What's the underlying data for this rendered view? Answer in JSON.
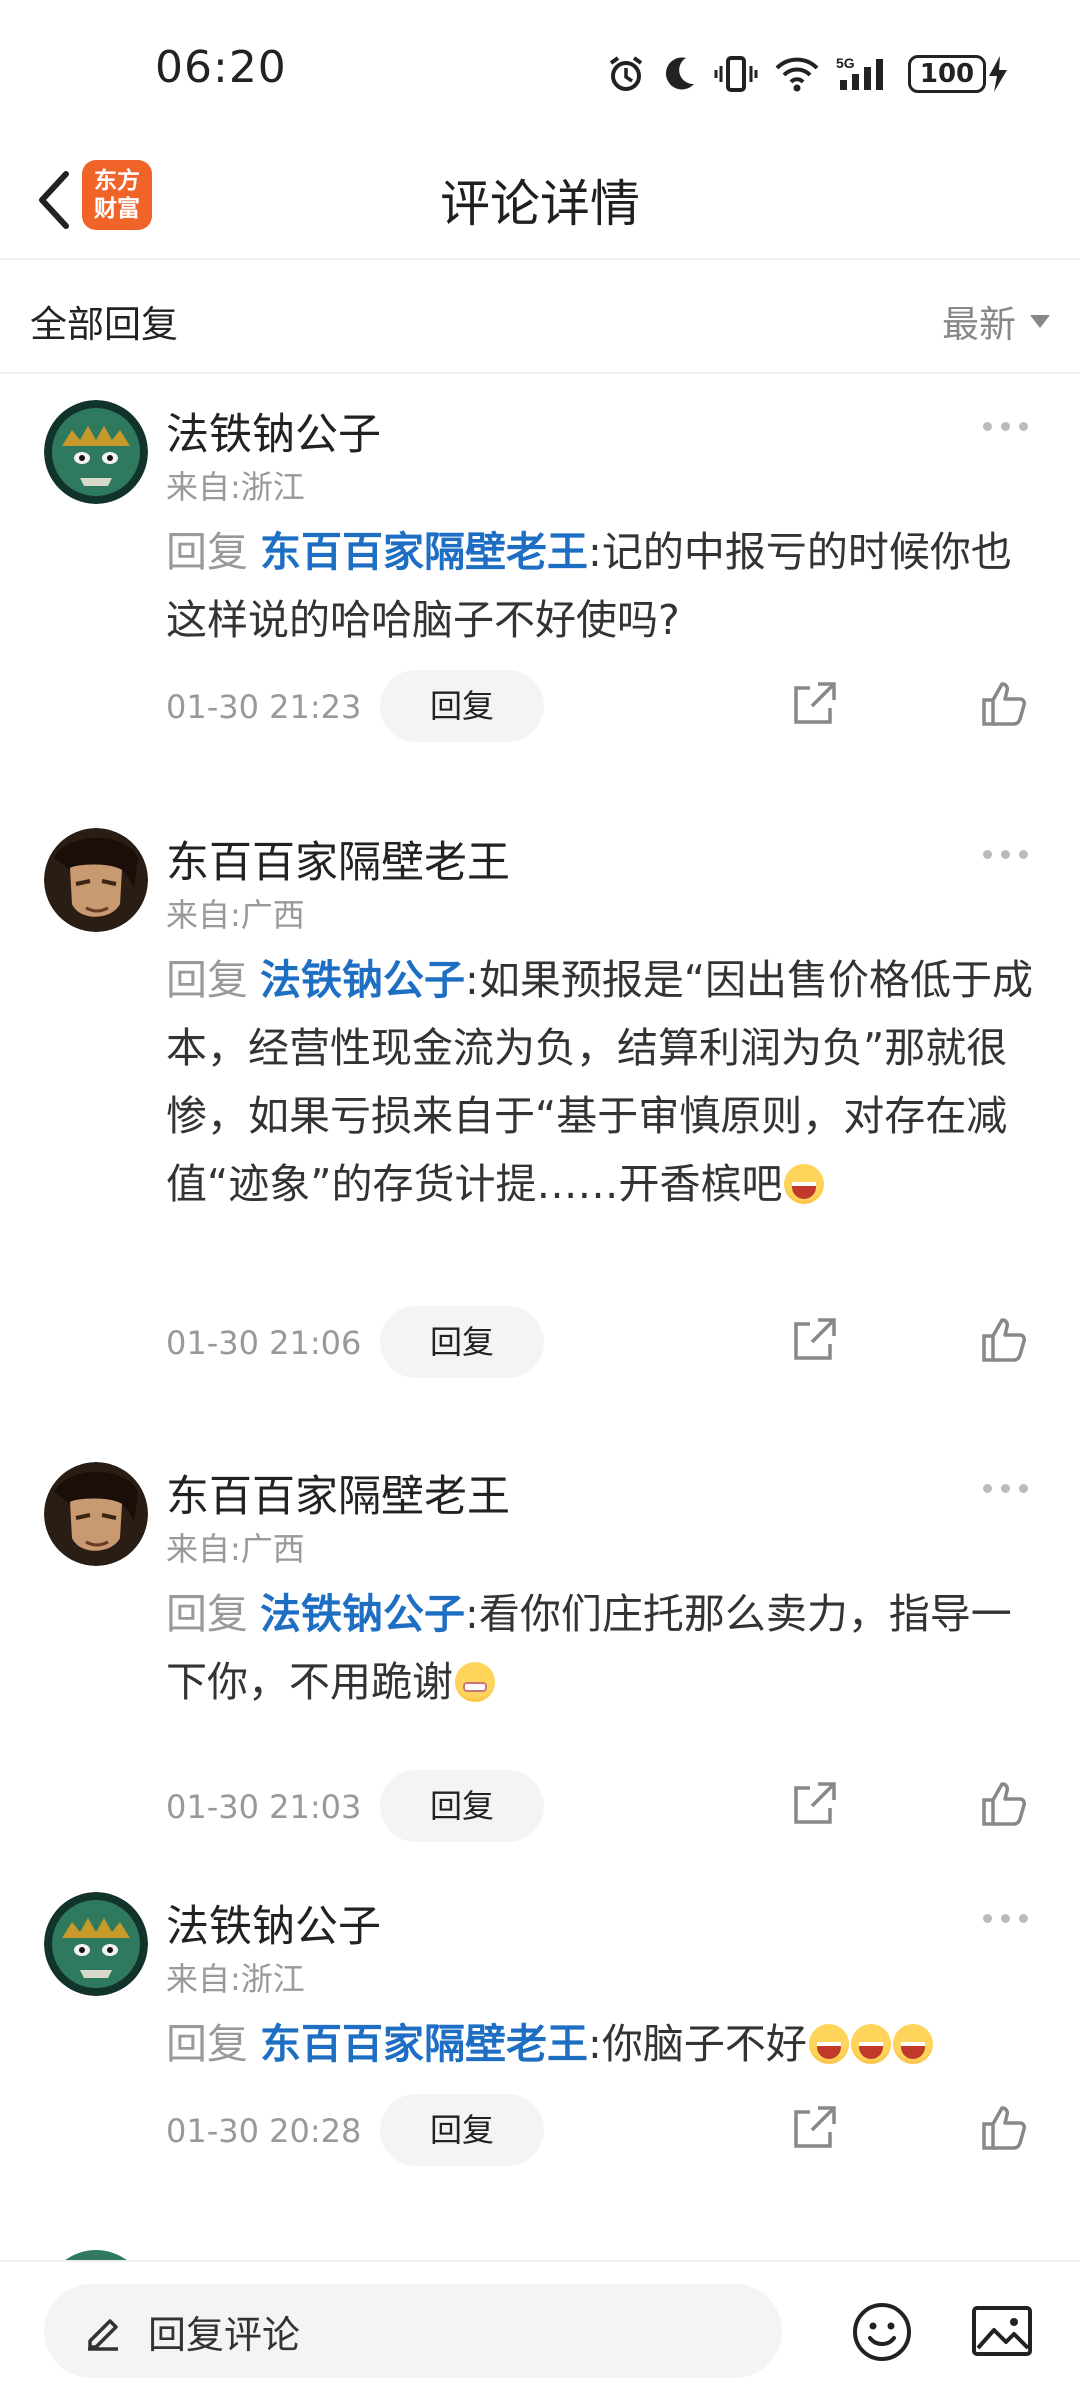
{
  "status_bar": {
    "time": "06:20",
    "battery": "100",
    "network": "5G"
  },
  "header": {
    "title": "评论详情",
    "logo_line1": "东方",
    "logo_line2": "财富"
  },
  "filter": {
    "label": "全部回复",
    "sort": "最新"
  },
  "comments": [
    {
      "name": "法铁钠公子",
      "location": "来自:浙江",
      "reply_prefix": "回复",
      "reply_to": "东百百家隔壁老王",
      "text": ":记的中报亏的时候你也这样说的哈哈脑子不好使吗?",
      "date": "01-30 21:23",
      "reply_label": "回复"
    },
    {
      "name": "东百百家隔壁老王",
      "location": "来自:广西",
      "reply_prefix": "回复",
      "reply_to": "法铁钠公子",
      "text": ":如果预报是“因出售价格低于成本，经营性现金流为负，结算利润为负”那就很惨，如果亏损来自于“基于审慎原则，对存在减值“迹象”的存货计提……开香槟吧",
      "date": "01-30 21:06",
      "reply_label": "回复"
    },
    {
      "name": "东百百家隔壁老王",
      "location": "来自:广西",
      "reply_prefix": "回复",
      "reply_to": "法铁钠公子",
      "text": ":看你们庄托那么卖力，指导一下你，不用跪谢",
      "date": "01-30 21:03",
      "reply_label": "回复"
    },
    {
      "name": "法铁钠公子",
      "location": "来自:浙江",
      "reply_prefix": "回复",
      "reply_to": "东百百家隔壁老王",
      "text": ":你脑子不好",
      "date": "01-30 20:28",
      "reply_label": "回复"
    }
  ],
  "bottom_bar": {
    "placeholder": "回复评论"
  },
  "colors": {
    "link": "#1e6fc4",
    "brand": "#f0642a",
    "muted": "#999999"
  }
}
